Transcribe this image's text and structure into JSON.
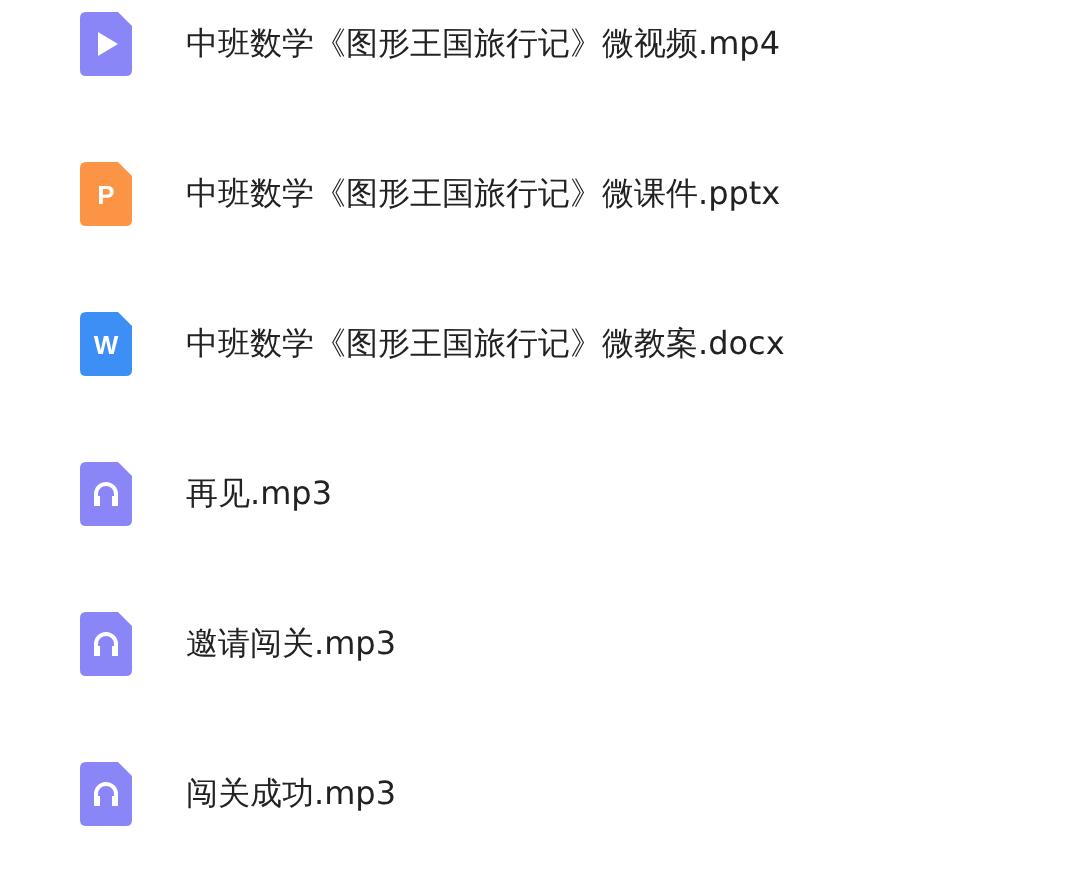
{
  "files": [
    {
      "kind": "video",
      "name": "中班数学《图形王国旅行记》微视频.mp4"
    },
    {
      "kind": "slides",
      "letter": "P",
      "name": "中班数学《图形王国旅行记》微课件.pptx"
    },
    {
      "kind": "doc",
      "letter": "W",
      "name": "中班数学《图形王国旅行记》微教案.docx"
    },
    {
      "kind": "audio",
      "name": "再见.mp3"
    },
    {
      "kind": "audio",
      "name": "邀请闯关.mp3"
    },
    {
      "kind": "audio",
      "name": "闯关成功.mp3"
    }
  ]
}
